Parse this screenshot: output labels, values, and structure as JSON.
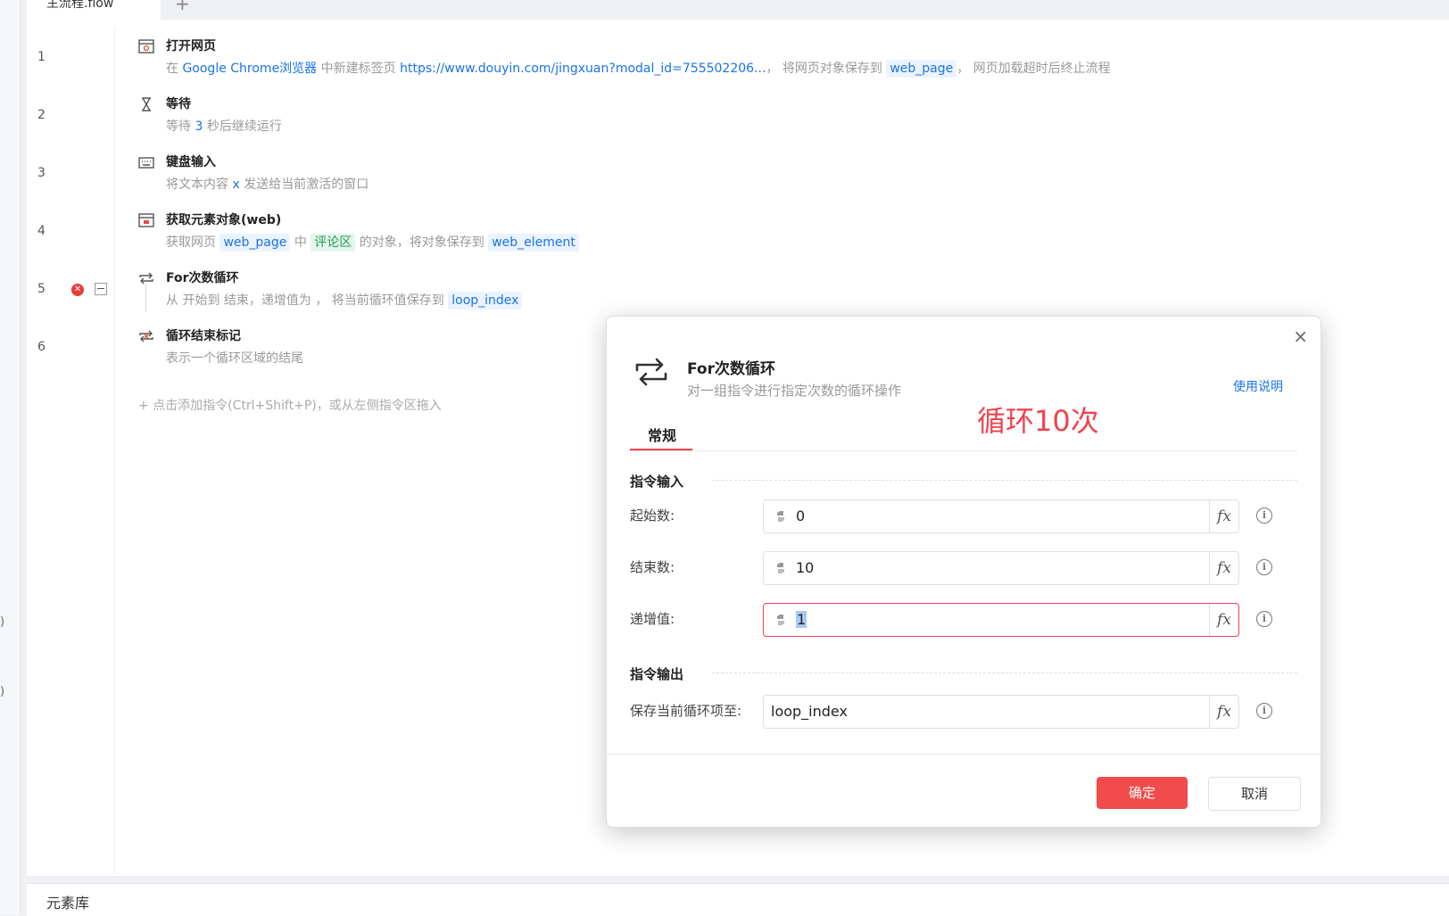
{
  "tabs": {
    "main_tab": "主流程.flow",
    "add_symbol": "+"
  },
  "left_fragments": [
    ")",
    ")"
  ],
  "commands": [
    {
      "line": "1",
      "title": "打开网页",
      "icon": "browser-open-icon"
    },
    {
      "line": "2",
      "title": "等待",
      "icon": "hourglass-icon"
    },
    {
      "line": "3",
      "title": "键盘输入",
      "icon": "keyboard-icon"
    },
    {
      "line": "4",
      "title": "获取元素对象(web)",
      "icon": "web-element-icon"
    },
    {
      "line": "5",
      "title": "For次数循环",
      "icon": "loop-icon"
    },
    {
      "line": "6",
      "title": "循环结束标记",
      "icon": "loop-end-icon"
    }
  ],
  "desc": {
    "c1": {
      "p1": "在 ",
      "browser": "Google Chrome浏览器",
      "p2": " 中新建标签页 ",
      "url": "https://www.douyin.com/jingxuan?modal_id=755502206...",
      "p3": "， 将网页对象保存到 ",
      "var": "web_page",
      "p4": "， 网页加载超时后终止流程"
    },
    "c2": {
      "p1": "等待 ",
      "seconds": "3",
      "p2": " 秒后继续运行"
    },
    "c3": {
      "p1": "将文本内容 ",
      "text": "x",
      "p2": " 发送给当前激活的窗口"
    },
    "c4": {
      "p1": "获取网页 ",
      "page": "web_page",
      "p2": " 中 ",
      "element": "评论区",
      "p3": " 的对象，将对象保存到 ",
      "var": "web_element"
    },
    "c5": {
      "p1": "从 开始到 结束，递增值为 ， 将当前循环值保存到 ",
      "var": "loop_index"
    },
    "c6": {
      "p1": "表示一个循环区域的结尾"
    }
  },
  "add_hint": "+ 点击添加指令(Ctrl+Shift+P)，或从左侧指令区拖入",
  "bottom_panel": {
    "title": "元素库"
  },
  "dialog": {
    "title": "For次数循环",
    "subtitle": "对一组指令进行指定次数的循环操作",
    "help_link": "使用说明",
    "annotation": "循环10次",
    "tab_regular": "常规",
    "section_input": "指令输入",
    "section_output": "指令输出",
    "fields": {
      "start": {
        "label": "起始数:",
        "value": "0"
      },
      "end": {
        "label": "结束数:",
        "value": "10"
      },
      "step": {
        "label": "递增值:",
        "value": "1"
      },
      "save": {
        "label": "保存当前循环项至:",
        "value": "loop_index"
      }
    },
    "fx": "fx",
    "info": "i",
    "close": "×",
    "ok": "确定",
    "cancel": "取消"
  },
  "colors": {
    "accent_red": "#f0434f",
    "link_blue": "#1a73e8",
    "green_chip": "#1f9d55"
  }
}
